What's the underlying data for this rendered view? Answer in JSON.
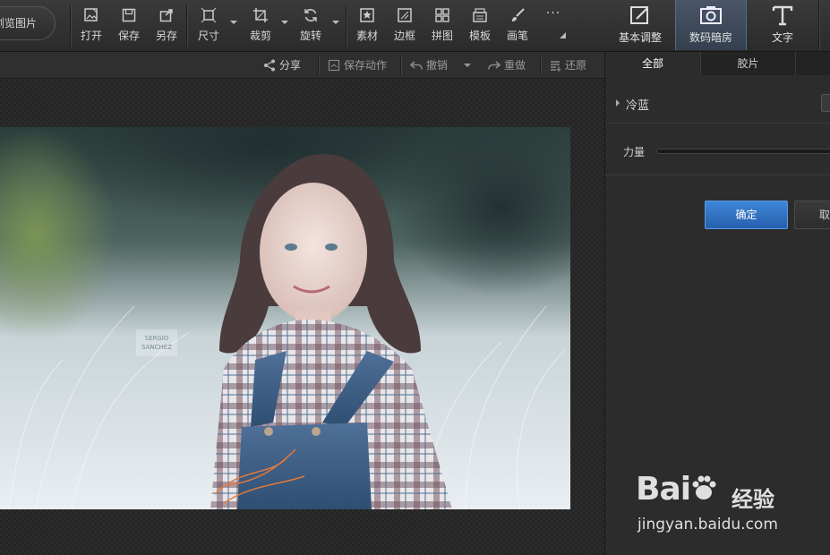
{
  "toolbar": {
    "browse_label": "浏览图片",
    "tools": [
      {
        "label": "打开",
        "icon": "open-image-icon"
      },
      {
        "label": "保存",
        "icon": "save-icon"
      },
      {
        "label": "另存",
        "icon": "save-as-icon"
      },
      {
        "label": "尺寸",
        "icon": "resize-icon"
      },
      {
        "label": "裁剪",
        "icon": "crop-icon"
      },
      {
        "label": "旋转",
        "icon": "rotate-icon"
      },
      {
        "label": "素材",
        "icon": "sticker-icon"
      },
      {
        "label": "边框",
        "icon": "frame-icon"
      },
      {
        "label": "拼图",
        "icon": "collage-icon"
      },
      {
        "label": "模板",
        "icon": "template-icon"
      },
      {
        "label": "画笔",
        "icon": "brush-icon"
      }
    ],
    "more_label": "···",
    "modes": [
      {
        "label": "基本调整",
        "icon": "basic-adjust-icon"
      },
      {
        "label": "数码暗房",
        "icon": "darkroom-camera-icon",
        "active": true
      },
      {
        "label": "文字",
        "icon": "text-t-icon"
      }
    ]
  },
  "actions": {
    "share": "分享",
    "save_action": "保存动作",
    "undo": "撤销",
    "redo": "重做",
    "restore": "还原"
  },
  "panel": {
    "tabs": [
      "全部",
      "胶片",
      ""
    ],
    "filter_name": "冷蓝",
    "slider_label": "力量",
    "confirm": "确定",
    "cancel": "取消"
  },
  "photo": {
    "watermark_text_1": "SERGIO",
    "watermark_text_2": "SANCHEZ"
  },
  "watermark": {
    "logo": "Bai",
    "logo2": "du",
    "cn": "经验",
    "url": "jingyan.baidu.com"
  },
  "colors": {
    "accent": "#2f74c8",
    "toolbar_bg": "#333333",
    "panel_bg": "#2c2c2c"
  }
}
